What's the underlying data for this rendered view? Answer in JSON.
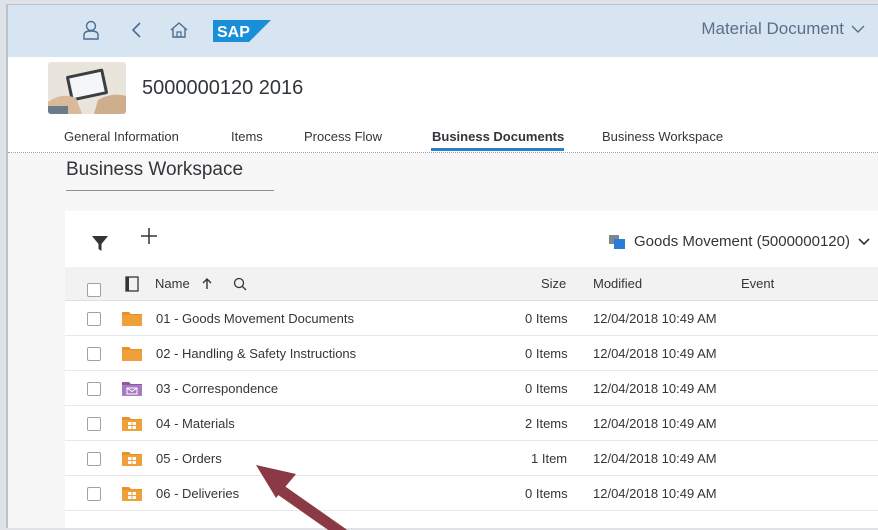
{
  "shell": {
    "title": "Material Document",
    "logo_text": "SAP",
    "icons": [
      "user-icon",
      "back-icon",
      "home-icon",
      "chevron-down-icon"
    ]
  },
  "object": {
    "title": "5000000120 2016"
  },
  "tabs": [
    {
      "label": "General Information",
      "active": false
    },
    {
      "label": "Items",
      "active": false
    },
    {
      "label": "Process Flow",
      "active": false
    },
    {
      "label": "Business Documents",
      "active": true
    },
    {
      "label": "Business Workspace",
      "active": false
    }
  ],
  "section": {
    "title": "Business Workspace"
  },
  "toolbar": {
    "breadcrumb": "Goods Movement (5000000120)"
  },
  "table": {
    "columns": {
      "name": "Name",
      "size": "Size",
      "modified": "Modified",
      "event": "Event"
    },
    "rows": [
      {
        "name": "01 - Goods Movement Documents",
        "size": "0 Items",
        "modified": "12/04/2018 10:49 AM",
        "icon": "folder-icon"
      },
      {
        "name": "02 - Handling & Safety Instructions",
        "size": "0 Items",
        "modified": "12/04/2018 10:49 AM",
        "icon": "folder-icon"
      },
      {
        "name": "03 - Correspondence",
        "size": "0 Items",
        "modified": "12/04/2018 10:49 AM",
        "icon": "mail-folder-icon"
      },
      {
        "name": "04 - Materials",
        "size": "2 Items",
        "modified": "12/04/2018 10:49 AM",
        "icon": "grid-folder-icon"
      },
      {
        "name": "05 - Orders",
        "size": "1 Item",
        "modified": "12/04/2018 10:49 AM",
        "icon": "grid-folder-icon"
      },
      {
        "name": "06 - Deliveries",
        "size": "0 Items",
        "modified": "12/04/2018 10:49 AM",
        "icon": "grid-folder-icon"
      }
    ]
  },
  "colors": {
    "shell_bg": "#d7e5f2",
    "accent": "#2b7cd3",
    "folder_orange": "#e8912c",
    "folder_purple": "#9b6fb5",
    "annotation_arrow": "#8b3a45"
  }
}
